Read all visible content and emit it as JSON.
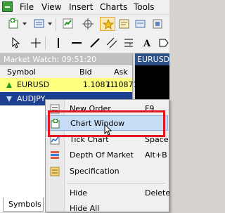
{
  "menubar": {
    "items": [
      "File",
      "View",
      "Insert",
      "Charts",
      "Tools"
    ]
  },
  "market_watch": {
    "title": "Market Watch: 09:51:20",
    "columns": {
      "symbol": "Symbol",
      "bid": "Bid",
      "ask": "Ask"
    },
    "rows": [
      {
        "symbol": "EURUSD",
        "bid": "1.10871",
        "ask": "1.10871",
        "direction": "up",
        "selected": true
      },
      {
        "symbol": "AUDJPY",
        "bid": "",
        "ask": "",
        "direction": "down",
        "selected": false
      }
    ],
    "tab_label": "Symbols"
  },
  "chart": {
    "title": "EURUSD,H"
  },
  "context_menu": {
    "items": [
      {
        "label": "New Order",
        "shortcut": "F9",
        "icon": "new-order-icon"
      },
      {
        "label": "Chart Window",
        "shortcut": "",
        "icon": "chart-window-icon",
        "highlighted": true
      },
      {
        "label": "Tick Chart",
        "shortcut": "Space",
        "icon": "tick-chart-icon"
      },
      {
        "label": "Depth Of Market",
        "shortcut": "Alt+B",
        "icon": "depth-of-market-icon"
      },
      {
        "label": "Specification",
        "shortcut": "",
        "icon": "specification-icon"
      },
      {
        "label": "Hide",
        "shortcut": "Delete",
        "icon": ""
      },
      {
        "label": "Hide All",
        "shortcut": "",
        "icon": ""
      }
    ]
  },
  "colors": {
    "selected_row": "#ffff7f",
    "selected_row_dark": "#1c3f8f",
    "highlight_border": "#e3171f",
    "menu_hover": "#c7dcf5"
  }
}
